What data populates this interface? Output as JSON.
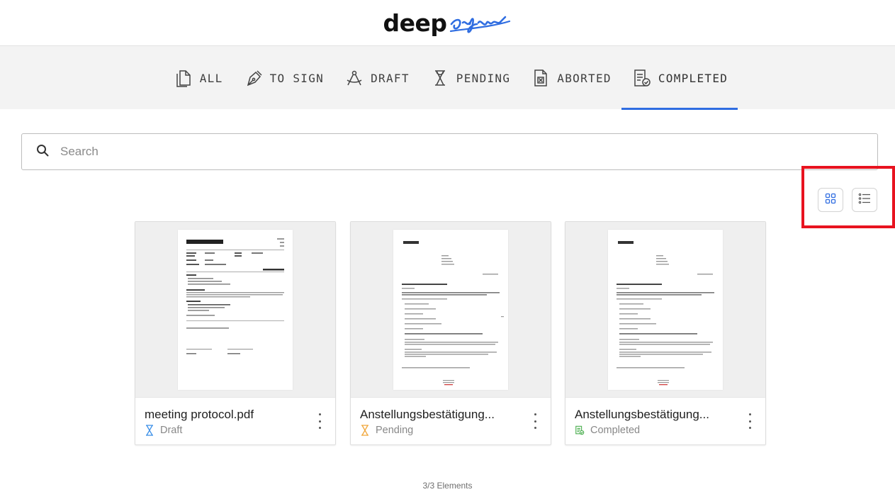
{
  "logo": {
    "prefix": "deep",
    "script_word": "sign"
  },
  "tabs": [
    {
      "label": "ALL",
      "icon": "files-icon",
      "active": false
    },
    {
      "label": "TO SIGN",
      "icon": "pen-nib-icon",
      "active": false
    },
    {
      "label": "DRAFT",
      "icon": "compass-draft-icon",
      "active": false
    },
    {
      "label": "PENDING",
      "icon": "hourglass-icon",
      "active": false
    },
    {
      "label": "ABORTED",
      "icon": "document-x-icon",
      "active": false
    },
    {
      "label": "COMPLETED",
      "icon": "document-check-icon",
      "active": true
    }
  ],
  "search": {
    "placeholder": "Search",
    "value": ""
  },
  "view_toggles": {
    "grid_icon": "grid-view-icon",
    "list_icon": "list-view-icon"
  },
  "colors": {
    "accent": "#2f6de1",
    "draft": "#3b8fe8",
    "pending": "#f0a63a",
    "completed": "#4caf50",
    "highlight": "#e8131f"
  },
  "cards": [
    {
      "name": "meeting protocol.pdf",
      "status": "Draft",
      "status_icon": "hourglass-icon"
    },
    {
      "name": "Anstellungsbestätigung...",
      "status": "Pending",
      "status_icon": "hourglass-icon"
    },
    {
      "name": "Anstellungsbestätigung...",
      "status": "Completed",
      "status_icon": "document-check-icon"
    }
  ],
  "footer": {
    "count": "3/3 Elements"
  }
}
